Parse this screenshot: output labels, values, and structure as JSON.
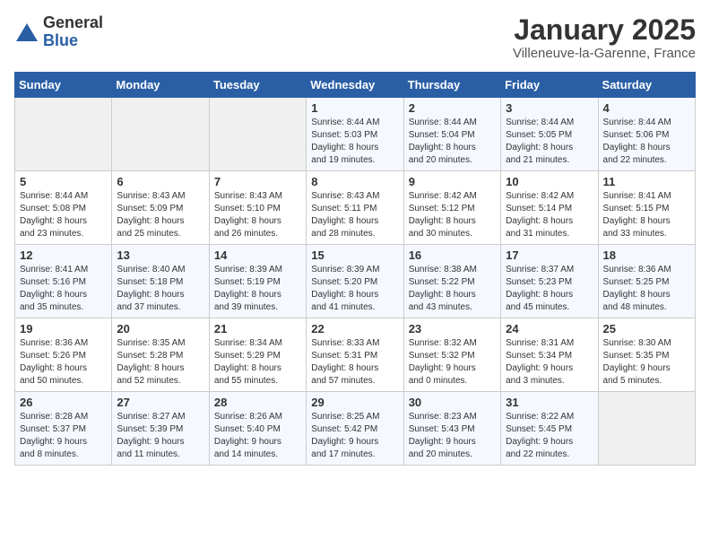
{
  "logo": {
    "text_general": "General",
    "text_blue": "Blue"
  },
  "title": {
    "month": "January 2025",
    "location": "Villeneuve-la-Garenne, France"
  },
  "weekdays": [
    "Sunday",
    "Monday",
    "Tuesday",
    "Wednesday",
    "Thursday",
    "Friday",
    "Saturday"
  ],
  "weeks": [
    [
      {
        "day": "",
        "info": ""
      },
      {
        "day": "",
        "info": ""
      },
      {
        "day": "",
        "info": ""
      },
      {
        "day": "1",
        "info": "Sunrise: 8:44 AM\nSunset: 5:03 PM\nDaylight: 8 hours\nand 19 minutes."
      },
      {
        "day": "2",
        "info": "Sunrise: 8:44 AM\nSunset: 5:04 PM\nDaylight: 8 hours\nand 20 minutes."
      },
      {
        "day": "3",
        "info": "Sunrise: 8:44 AM\nSunset: 5:05 PM\nDaylight: 8 hours\nand 21 minutes."
      },
      {
        "day": "4",
        "info": "Sunrise: 8:44 AM\nSunset: 5:06 PM\nDaylight: 8 hours\nand 22 minutes."
      }
    ],
    [
      {
        "day": "5",
        "info": "Sunrise: 8:44 AM\nSunset: 5:08 PM\nDaylight: 8 hours\nand 23 minutes."
      },
      {
        "day": "6",
        "info": "Sunrise: 8:43 AM\nSunset: 5:09 PM\nDaylight: 8 hours\nand 25 minutes."
      },
      {
        "day": "7",
        "info": "Sunrise: 8:43 AM\nSunset: 5:10 PM\nDaylight: 8 hours\nand 26 minutes."
      },
      {
        "day": "8",
        "info": "Sunrise: 8:43 AM\nSunset: 5:11 PM\nDaylight: 8 hours\nand 28 minutes."
      },
      {
        "day": "9",
        "info": "Sunrise: 8:42 AM\nSunset: 5:12 PM\nDaylight: 8 hours\nand 30 minutes."
      },
      {
        "day": "10",
        "info": "Sunrise: 8:42 AM\nSunset: 5:14 PM\nDaylight: 8 hours\nand 31 minutes."
      },
      {
        "day": "11",
        "info": "Sunrise: 8:41 AM\nSunset: 5:15 PM\nDaylight: 8 hours\nand 33 minutes."
      }
    ],
    [
      {
        "day": "12",
        "info": "Sunrise: 8:41 AM\nSunset: 5:16 PM\nDaylight: 8 hours\nand 35 minutes."
      },
      {
        "day": "13",
        "info": "Sunrise: 8:40 AM\nSunset: 5:18 PM\nDaylight: 8 hours\nand 37 minutes."
      },
      {
        "day": "14",
        "info": "Sunrise: 8:39 AM\nSunset: 5:19 PM\nDaylight: 8 hours\nand 39 minutes."
      },
      {
        "day": "15",
        "info": "Sunrise: 8:39 AM\nSunset: 5:20 PM\nDaylight: 8 hours\nand 41 minutes."
      },
      {
        "day": "16",
        "info": "Sunrise: 8:38 AM\nSunset: 5:22 PM\nDaylight: 8 hours\nand 43 minutes."
      },
      {
        "day": "17",
        "info": "Sunrise: 8:37 AM\nSunset: 5:23 PM\nDaylight: 8 hours\nand 45 minutes."
      },
      {
        "day": "18",
        "info": "Sunrise: 8:36 AM\nSunset: 5:25 PM\nDaylight: 8 hours\nand 48 minutes."
      }
    ],
    [
      {
        "day": "19",
        "info": "Sunrise: 8:36 AM\nSunset: 5:26 PM\nDaylight: 8 hours\nand 50 minutes."
      },
      {
        "day": "20",
        "info": "Sunrise: 8:35 AM\nSunset: 5:28 PM\nDaylight: 8 hours\nand 52 minutes."
      },
      {
        "day": "21",
        "info": "Sunrise: 8:34 AM\nSunset: 5:29 PM\nDaylight: 8 hours\nand 55 minutes."
      },
      {
        "day": "22",
        "info": "Sunrise: 8:33 AM\nSunset: 5:31 PM\nDaylight: 8 hours\nand 57 minutes."
      },
      {
        "day": "23",
        "info": "Sunrise: 8:32 AM\nSunset: 5:32 PM\nDaylight: 9 hours\nand 0 minutes."
      },
      {
        "day": "24",
        "info": "Sunrise: 8:31 AM\nSunset: 5:34 PM\nDaylight: 9 hours\nand 3 minutes."
      },
      {
        "day": "25",
        "info": "Sunrise: 8:30 AM\nSunset: 5:35 PM\nDaylight: 9 hours\nand 5 minutes."
      }
    ],
    [
      {
        "day": "26",
        "info": "Sunrise: 8:28 AM\nSunset: 5:37 PM\nDaylight: 9 hours\nand 8 minutes."
      },
      {
        "day": "27",
        "info": "Sunrise: 8:27 AM\nSunset: 5:39 PM\nDaylight: 9 hours\nand 11 minutes."
      },
      {
        "day": "28",
        "info": "Sunrise: 8:26 AM\nSunset: 5:40 PM\nDaylight: 9 hours\nand 14 minutes."
      },
      {
        "day": "29",
        "info": "Sunrise: 8:25 AM\nSunset: 5:42 PM\nDaylight: 9 hours\nand 17 minutes."
      },
      {
        "day": "30",
        "info": "Sunrise: 8:23 AM\nSunset: 5:43 PM\nDaylight: 9 hours\nand 20 minutes."
      },
      {
        "day": "31",
        "info": "Sunrise: 8:22 AM\nSunset: 5:45 PM\nDaylight: 9 hours\nand 22 minutes."
      },
      {
        "day": "",
        "info": ""
      }
    ]
  ]
}
